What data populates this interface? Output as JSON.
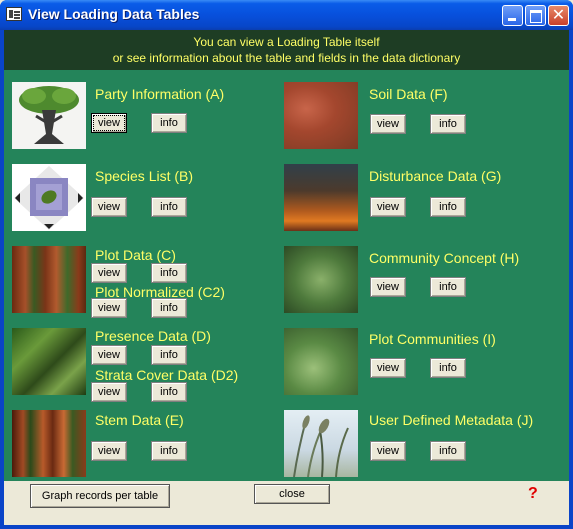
{
  "window": {
    "title": "View Loading Data Tables",
    "close_glyph": "✕"
  },
  "header": {
    "line1": "You can view a Loading Table itself",
    "line2": "or see information about the table and fields in the data dictionary"
  },
  "buttons": {
    "view": "view",
    "info": "info"
  },
  "tables": {
    "party": "Party Information (A)",
    "species": "Species List (B)",
    "plot": "Plot Data (C)",
    "plot_normalized": "Plot Normalized (C2)",
    "presence": "Presence Data (D)",
    "strata": "Strata Cover Data (D2)",
    "stem": "Stem Data (E)",
    "soil": "Soil Data (F)",
    "disturbance": "Disturbance Data (G)",
    "community_concept": "Community Concept (H)",
    "plot_communities": "Plot Communities (I)",
    "user_metadata": "User Defined Metadata (J)"
  },
  "footer": {
    "graph_button": "Graph records per table",
    "close_button": "close",
    "help_glyph": "?"
  },
  "colors": {
    "form_bg": "#24845a",
    "header_bg": "#1e3d24",
    "label_text": "#ffff66",
    "help": "#e00000"
  },
  "icons": {
    "party": "tree-icon",
    "species": "leaf-icon",
    "plot": "redwood-forest-image",
    "presence": "jungle-image",
    "stem": "redwood-stems-image",
    "soil": "soil-image",
    "disturbance": "fire-image",
    "community": "fern-image",
    "plot_communities": "fern-image",
    "user_metadata": "grass-image"
  }
}
